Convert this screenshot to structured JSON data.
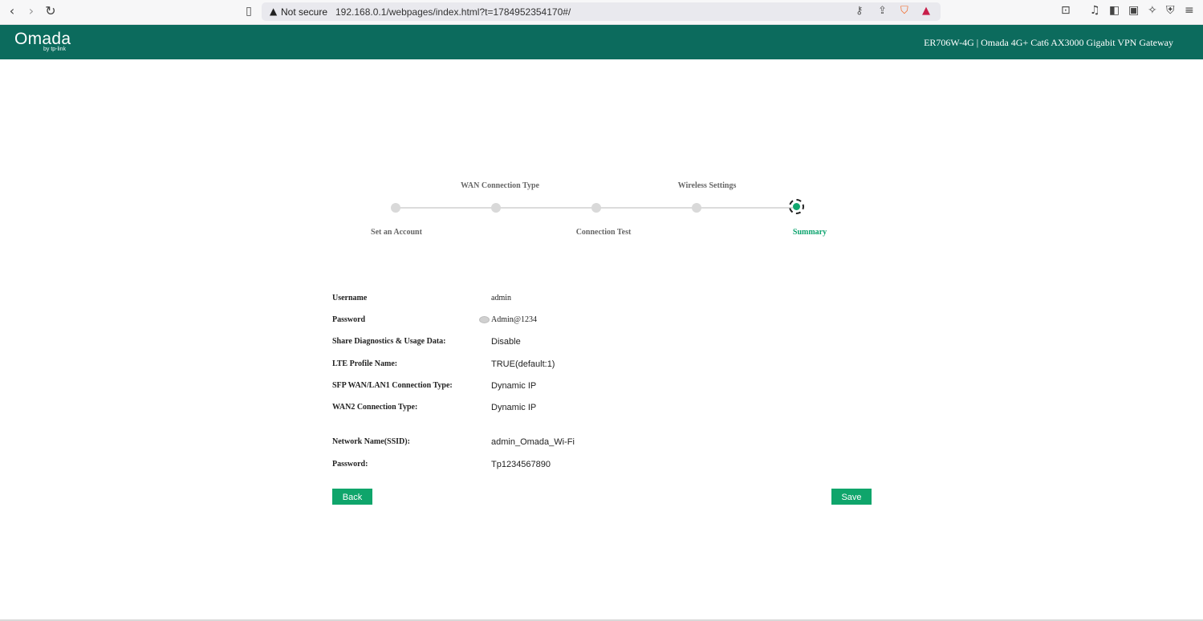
{
  "browser": {
    "security_label": "Not secure",
    "url": "192.168.0.1/webpages/index.html?t=1784952354170#/"
  },
  "header": {
    "logo": "Omada",
    "logo_sub": "by tp-link",
    "model_info": "ER706W-4G  |  Omada 4G+ Cat6 AX3000 Gigabit VPN Gateway"
  },
  "stepper": {
    "steps": [
      {
        "label": "Set an Account",
        "state": "done"
      },
      {
        "label": "WAN Connection Type",
        "state": "done"
      },
      {
        "label": "Connection Test",
        "state": "done"
      },
      {
        "label": "Wireless Settings",
        "state": "done"
      },
      {
        "label": "Summary",
        "state": "current"
      }
    ],
    "active_color": "#12a66e"
  },
  "summary": {
    "username_label": "Username",
    "username_value": "admin",
    "password_label": "Password",
    "password_value": "Admin@1234",
    "diagnostics_label": "Share Diagnostics & Usage Data:",
    "diagnostics_value": "Disable",
    "lte_label": "LTE Profile Name:",
    "lte_value": "TRUE(default:1)",
    "sfp_label": "SFP WAN/LAN1 Connection Type:",
    "sfp_value": "Dynamic IP",
    "wan2_label": "WAN2 Connection Type:",
    "wan2_value": "Dynamic IP",
    "ssid_label": "Network Name(SSID):",
    "ssid_value": "admin_Omada_Wi-Fi",
    "wifi_password_label": "Password:",
    "wifi_password_value": "Tp1234567890"
  },
  "actions": {
    "back_label": "Back",
    "save_label": "Save"
  },
  "colors": {
    "header_bg": "#0c6b5d",
    "button_bg": "#0fa56b"
  }
}
